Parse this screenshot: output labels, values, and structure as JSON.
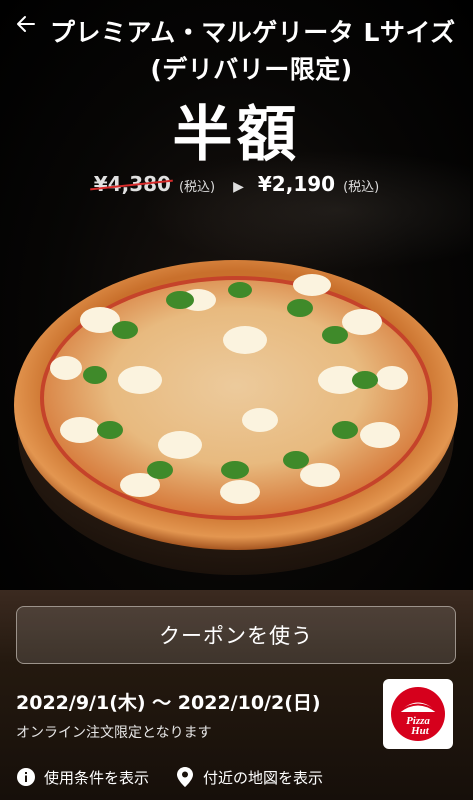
{
  "header": {
    "title_line1": "プレミアム・マルゲリータ Lサイズ",
    "title_line2": "(デリバリー限定)"
  },
  "promo": {
    "headline": "半額",
    "original_price": "¥4,380",
    "original_tax": "(税込)",
    "arrow": "▶",
    "sale_price": "¥2,190",
    "sale_tax": "(税込)"
  },
  "coupon": {
    "button_label": "クーポンを使う",
    "period": "2022/9/1(木) 〜 2022/10/2(日)",
    "note": "オンライン注文限定となります"
  },
  "links": {
    "terms_label": "使用条件を表示",
    "map_label": "付近の地図を表示"
  },
  "brand": {
    "logo_text": "Pizza Hut",
    "logo_color": "#d6001c"
  },
  "icons": {
    "back": "back-arrow-icon",
    "terms": "info-icon",
    "map": "map-pin-icon"
  }
}
